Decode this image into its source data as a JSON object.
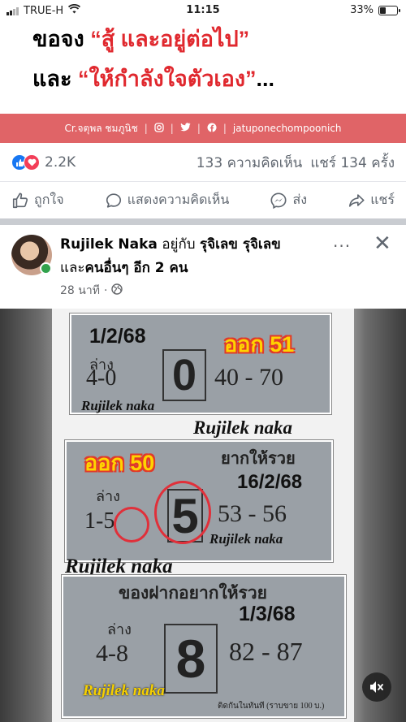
{
  "status_bar": {
    "carrier": "TRUE-H",
    "time": "11:15",
    "battery": "33%"
  },
  "banner": {
    "line1_black": "ขอจง",
    "line1_red": "“สู้ และอยู่ต่อไป”",
    "line2_black": "และ",
    "line2_red": "“ให้กำลังใจตัวเอง”",
    "line2_end": "...",
    "credit_name": "Cr.จตุพล ชมภูนิช",
    "credit_handle": "jatuponechompoonich"
  },
  "reactions": {
    "count": "2.2K",
    "comments": "133 ความคิดเห็น",
    "shares": "แชร์ 134 ครั้ง"
  },
  "actions": {
    "like": "ถูกใจ",
    "comment": "แสดงความคิดเห็น",
    "send": "ส่ง",
    "share": "แชร์"
  },
  "post": {
    "author": "Rujilek Naka",
    "with_text": "อยู่กับ",
    "tagged1": "รุจิเลข รุจิเลข",
    "and_text": "และ",
    "others": "คนอื่นๆ อีก 2 คน",
    "time": "28 นาที",
    "more": "···",
    "close": "✕"
  },
  "image_cards": [
    {
      "date": "1/2/68",
      "result": "ออก 51",
      "label": "ล่าง",
      "left": "4-0",
      "big": "0",
      "right": "40 - 70",
      "watermark": "Rujilek naka"
    },
    {
      "date": "16/2/68",
      "result": "ออก 50",
      "label": "ล่าง",
      "left": "1-5",
      "big": "5",
      "right": "53 - 56",
      "watermark": "Rujilek naka",
      "heading": "ยากให้รวย"
    },
    {
      "date": "1/3/68",
      "label": "ล่าง",
      "left": "4-8",
      "big": "8",
      "right": "82 - 87",
      "watermark": "Rujilek naka",
      "heading": "ของฝากอยากให้รวย",
      "footnote": "ติดกันในทันที (ราบขาย 100 บ.)"
    }
  ],
  "overlay_watermarks": [
    "Rujilek naka",
    "Rujilek naka"
  ],
  "colors": {
    "banner_red": "#e0282e",
    "credit_bar": "#e06467",
    "fb_blue": "#1877f2",
    "love_red": "#f33e58",
    "online_green": "#31a24c"
  }
}
